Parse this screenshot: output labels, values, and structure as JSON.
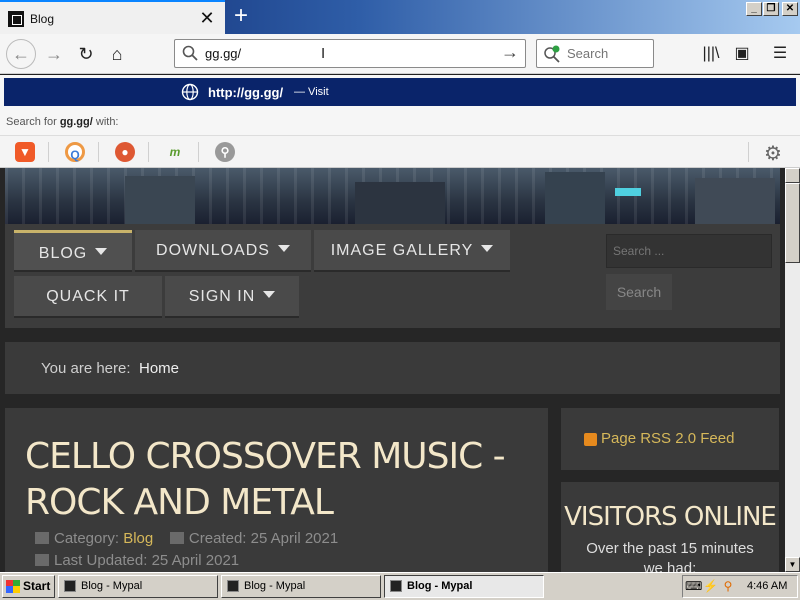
{
  "browser": {
    "tab_title": "Blog",
    "url": "gg.gg/",
    "search_placeholder": "Search",
    "suggestion": {
      "url": "http://gg.gg/",
      "action": "— Visit"
    },
    "search_for_prefix": "Search for ",
    "search_for_term": "gg.gg/",
    "search_for_suffix": " with:"
  },
  "site": {
    "menu": [
      {
        "label": "BLOG",
        "has_dropdown": true,
        "active": true
      },
      {
        "label": "DOWNLOADS",
        "has_dropdown": true,
        "active": false
      },
      {
        "label": "IMAGE GALLERY",
        "has_dropdown": true,
        "active": false
      },
      {
        "label": "QUACK IT",
        "has_dropdown": false,
        "active": false
      },
      {
        "label": "SIGN IN",
        "has_dropdown": true,
        "active": false
      }
    ],
    "search_placeholder": "Search ...",
    "search_button": "Search",
    "breadcrumb_label": "You are here:",
    "breadcrumb_home": "Home",
    "article": {
      "title": "CELLO CROSSOVER MUSIC - ROCK AND METAL",
      "category_label": "Category:",
      "category": "Blog",
      "created": "Created: 25 April 2021",
      "updated": "Last Updated: 25 April 2021"
    },
    "rss_link": "Page RSS 2.0 Feed",
    "visitors_title": "VISITORS ONLINE",
    "visitors_sub": "Over the past 15 minutes",
    "visitors_sub2": "we had:"
  },
  "taskbar": {
    "start": "Start",
    "tasks": [
      "Blog - Mypal",
      "Blog - Mypal",
      "Blog - Mypal"
    ],
    "clock": "4:46 AM"
  },
  "colors": {
    "accent_gold": "#d6b85a",
    "suggestion_highlight": "#0a246a"
  }
}
